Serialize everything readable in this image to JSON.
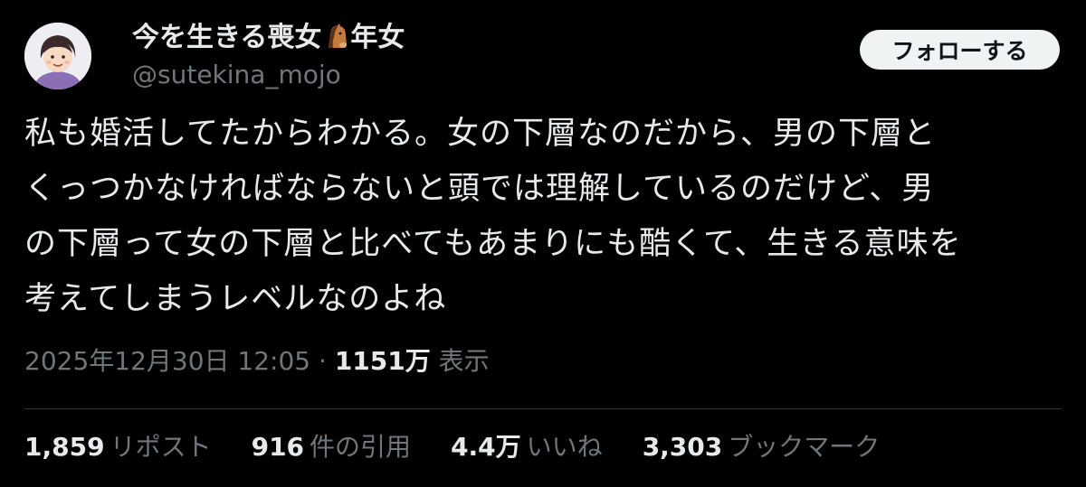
{
  "user": {
    "name_part1": "今を生きる喪女",
    "name_emoji": "horse-face-icon",
    "name_part2": "年女",
    "handle": "@sutekina_mojo"
  },
  "follow_button": {
    "label": "フォローする"
  },
  "tweet": {
    "lines": [
      "私も婚活してたからわかる。女の下層なのだから、男の下層と",
      "くっつかなければならないと頭では理解しているのだけど、男",
      "の下層って女の下層と比べてもあまりにも酷くて、生きる意味を",
      "考えてしまうレベルなのよね"
    ]
  },
  "meta": {
    "timestamp": "2025年12月30日 12:05",
    "separator": "·",
    "views_count": "1151万",
    "views_label": "表示"
  },
  "stats": [
    {
      "count": "1,859",
      "label": "リポスト"
    },
    {
      "count": "916",
      "label": "件の引用"
    },
    {
      "count": "4.4万",
      "label": "いいね"
    },
    {
      "count": "3,303",
      "label": "ブックマーク"
    }
  ],
  "colors": {
    "background": "#000000",
    "text": "#e7e9ea",
    "secondary_text": "#71767b",
    "button_bg": "#eff3f4"
  }
}
